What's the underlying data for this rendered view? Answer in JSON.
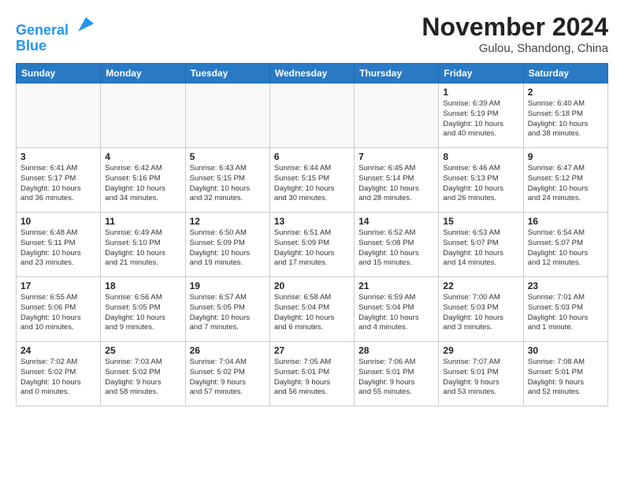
{
  "header": {
    "logo_line1": "General",
    "logo_line2": "Blue",
    "month": "November 2024",
    "location": "Gulou, Shandong, China"
  },
  "weekdays": [
    "Sunday",
    "Monday",
    "Tuesday",
    "Wednesday",
    "Thursday",
    "Friday",
    "Saturday"
  ],
  "weeks": [
    [
      {
        "day": "",
        "info": ""
      },
      {
        "day": "",
        "info": ""
      },
      {
        "day": "",
        "info": ""
      },
      {
        "day": "",
        "info": ""
      },
      {
        "day": "",
        "info": ""
      },
      {
        "day": "1",
        "info": "Sunrise: 6:39 AM\nSunset: 5:19 PM\nDaylight: 10 hours\nand 40 minutes."
      },
      {
        "day": "2",
        "info": "Sunrise: 6:40 AM\nSunset: 5:18 PM\nDaylight: 10 hours\nand 38 minutes."
      }
    ],
    [
      {
        "day": "3",
        "info": "Sunrise: 6:41 AM\nSunset: 5:17 PM\nDaylight: 10 hours\nand 36 minutes."
      },
      {
        "day": "4",
        "info": "Sunrise: 6:42 AM\nSunset: 5:16 PM\nDaylight: 10 hours\nand 34 minutes."
      },
      {
        "day": "5",
        "info": "Sunrise: 6:43 AM\nSunset: 5:15 PM\nDaylight: 10 hours\nand 32 minutes."
      },
      {
        "day": "6",
        "info": "Sunrise: 6:44 AM\nSunset: 5:15 PM\nDaylight: 10 hours\nand 30 minutes."
      },
      {
        "day": "7",
        "info": "Sunrise: 6:45 AM\nSunset: 5:14 PM\nDaylight: 10 hours\nand 28 minutes."
      },
      {
        "day": "8",
        "info": "Sunrise: 6:46 AM\nSunset: 5:13 PM\nDaylight: 10 hours\nand 26 minutes."
      },
      {
        "day": "9",
        "info": "Sunrise: 6:47 AM\nSunset: 5:12 PM\nDaylight: 10 hours\nand 24 minutes."
      }
    ],
    [
      {
        "day": "10",
        "info": "Sunrise: 6:48 AM\nSunset: 5:11 PM\nDaylight: 10 hours\nand 23 minutes."
      },
      {
        "day": "11",
        "info": "Sunrise: 6:49 AM\nSunset: 5:10 PM\nDaylight: 10 hours\nand 21 minutes."
      },
      {
        "day": "12",
        "info": "Sunrise: 6:50 AM\nSunset: 5:09 PM\nDaylight: 10 hours\nand 19 minutes."
      },
      {
        "day": "13",
        "info": "Sunrise: 6:51 AM\nSunset: 5:09 PM\nDaylight: 10 hours\nand 17 minutes."
      },
      {
        "day": "14",
        "info": "Sunrise: 6:52 AM\nSunset: 5:08 PM\nDaylight: 10 hours\nand 15 minutes."
      },
      {
        "day": "15",
        "info": "Sunrise: 6:53 AM\nSunset: 5:07 PM\nDaylight: 10 hours\nand 14 minutes."
      },
      {
        "day": "16",
        "info": "Sunrise: 6:54 AM\nSunset: 5:07 PM\nDaylight: 10 hours\nand 12 minutes."
      }
    ],
    [
      {
        "day": "17",
        "info": "Sunrise: 6:55 AM\nSunset: 5:06 PM\nDaylight: 10 hours\nand 10 minutes."
      },
      {
        "day": "18",
        "info": "Sunrise: 6:56 AM\nSunset: 5:05 PM\nDaylight: 10 hours\nand 9 minutes."
      },
      {
        "day": "19",
        "info": "Sunrise: 6:57 AM\nSunset: 5:05 PM\nDaylight: 10 hours\nand 7 minutes."
      },
      {
        "day": "20",
        "info": "Sunrise: 6:58 AM\nSunset: 5:04 PM\nDaylight: 10 hours\nand 6 minutes."
      },
      {
        "day": "21",
        "info": "Sunrise: 6:59 AM\nSunset: 5:04 PM\nDaylight: 10 hours\nand 4 minutes."
      },
      {
        "day": "22",
        "info": "Sunrise: 7:00 AM\nSunset: 5:03 PM\nDaylight: 10 hours\nand 3 minutes."
      },
      {
        "day": "23",
        "info": "Sunrise: 7:01 AM\nSunset: 5:03 PM\nDaylight: 10 hours\nand 1 minute."
      }
    ],
    [
      {
        "day": "24",
        "info": "Sunrise: 7:02 AM\nSunset: 5:02 PM\nDaylight: 10 hours\nand 0 minutes."
      },
      {
        "day": "25",
        "info": "Sunrise: 7:03 AM\nSunset: 5:02 PM\nDaylight: 9 hours\nand 58 minutes."
      },
      {
        "day": "26",
        "info": "Sunrise: 7:04 AM\nSunset: 5:02 PM\nDaylight: 9 hours\nand 57 minutes."
      },
      {
        "day": "27",
        "info": "Sunrise: 7:05 AM\nSunset: 5:01 PM\nDaylight: 9 hours\nand 56 minutes."
      },
      {
        "day": "28",
        "info": "Sunrise: 7:06 AM\nSunset: 5:01 PM\nDaylight: 9 hours\nand 55 minutes."
      },
      {
        "day": "29",
        "info": "Sunrise: 7:07 AM\nSunset: 5:01 PM\nDaylight: 9 hours\nand 53 minutes."
      },
      {
        "day": "30",
        "info": "Sunrise: 7:08 AM\nSunset: 5:01 PM\nDaylight: 9 hours\nand 52 minutes."
      }
    ]
  ]
}
